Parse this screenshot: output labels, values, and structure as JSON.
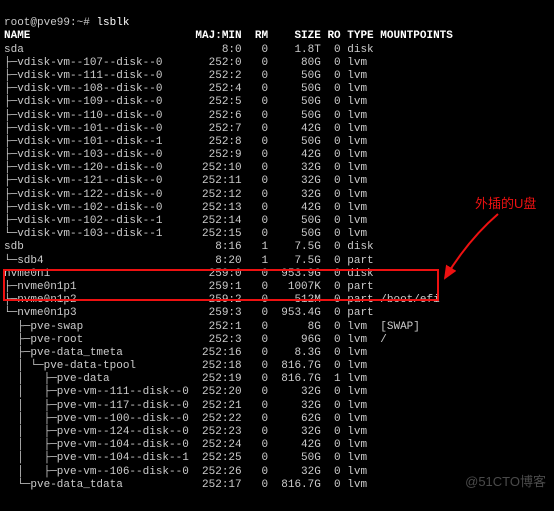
{
  "prompt": {
    "user": "root@pve99",
    "path": "~",
    "cmd": "lsblk"
  },
  "hdr": {
    "name": "NAME",
    "mm": "MAJ:MIN",
    "rm": "RM",
    "size": "SIZE",
    "ro": "RO",
    "type": "TYPE",
    "mp": "MOUNTPOINTS"
  },
  "rows": [
    {
      "n": "sda",
      "mm": "8:0",
      "rm": "0",
      "sz": "1.8T",
      "ro": "0",
      "ty": "disk",
      "mp": ""
    },
    {
      "n": "├─vdisk-vm--107--disk--0",
      "mm": "252:0",
      "rm": "0",
      "sz": "80G",
      "ro": "0",
      "ty": "lvm",
      "mp": ""
    },
    {
      "n": "├─vdisk-vm--111--disk--0",
      "mm": "252:2",
      "rm": "0",
      "sz": "50G",
      "ro": "0",
      "ty": "lvm",
      "mp": ""
    },
    {
      "n": "├─vdisk-vm--108--disk--0",
      "mm": "252:4",
      "rm": "0",
      "sz": "50G",
      "ro": "0",
      "ty": "lvm",
      "mp": ""
    },
    {
      "n": "├─vdisk-vm--109--disk--0",
      "mm": "252:5",
      "rm": "0",
      "sz": "50G",
      "ro": "0",
      "ty": "lvm",
      "mp": ""
    },
    {
      "n": "├─vdisk-vm--110--disk--0",
      "mm": "252:6",
      "rm": "0",
      "sz": "50G",
      "ro": "0",
      "ty": "lvm",
      "mp": ""
    },
    {
      "n": "├─vdisk-vm--101--disk--0",
      "mm": "252:7",
      "rm": "0",
      "sz": "42G",
      "ro": "0",
      "ty": "lvm",
      "mp": ""
    },
    {
      "n": "├─vdisk-vm--101--disk--1",
      "mm": "252:8",
      "rm": "0",
      "sz": "50G",
      "ro": "0",
      "ty": "lvm",
      "mp": ""
    },
    {
      "n": "├─vdisk-vm--103--disk--0",
      "mm": "252:9",
      "rm": "0",
      "sz": "42G",
      "ro": "0",
      "ty": "lvm",
      "mp": ""
    },
    {
      "n": "├─vdisk-vm--120--disk--0",
      "mm": "252:10",
      "rm": "0",
      "sz": "32G",
      "ro": "0",
      "ty": "lvm",
      "mp": ""
    },
    {
      "n": "├─vdisk-vm--121--disk--0",
      "mm": "252:11",
      "rm": "0",
      "sz": "32G",
      "ro": "0",
      "ty": "lvm",
      "mp": ""
    },
    {
      "n": "├─vdisk-vm--122--disk--0",
      "mm": "252:12",
      "rm": "0",
      "sz": "32G",
      "ro": "0",
      "ty": "lvm",
      "mp": ""
    },
    {
      "n": "├─vdisk-vm--102--disk--0",
      "mm": "252:13",
      "rm": "0",
      "sz": "42G",
      "ro": "0",
      "ty": "lvm",
      "mp": ""
    },
    {
      "n": "├─vdisk-vm--102--disk--1",
      "mm": "252:14",
      "rm": "0",
      "sz": "50G",
      "ro": "0",
      "ty": "lvm",
      "mp": ""
    },
    {
      "n": "└─vdisk-vm--103--disk--1",
      "mm": "252:15",
      "rm": "0",
      "sz": "50G",
      "ro": "0",
      "ty": "lvm",
      "mp": ""
    },
    {
      "n": "sdb",
      "mm": "8:16",
      "rm": "1",
      "sz": "7.5G",
      "ro": "0",
      "ty": "disk",
      "mp": ""
    },
    {
      "n": "└─sdb4",
      "mm": "8:20",
      "rm": "1",
      "sz": "7.5G",
      "ro": "0",
      "ty": "part",
      "mp": ""
    },
    {
      "n": "nvme0n1",
      "mm": "259:0",
      "rm": "0",
      "sz": "953.9G",
      "ro": "0",
      "ty": "disk",
      "mp": ""
    },
    {
      "n": "├─nvme0n1p1",
      "mm": "259:1",
      "rm": "0",
      "sz": "1007K",
      "ro": "0",
      "ty": "part",
      "mp": ""
    },
    {
      "n": "├─nvme0n1p2",
      "mm": "259:2",
      "rm": "0",
      "sz": "512M",
      "ro": "0",
      "ty": "part",
      "mp": "/boot/efi"
    },
    {
      "n": "└─nvme0n1p3",
      "mm": "259:3",
      "rm": "0",
      "sz": "953.4G",
      "ro": "0",
      "ty": "part",
      "mp": ""
    },
    {
      "n": "  ├─pve-swap",
      "mm": "252:1",
      "rm": "0",
      "sz": "8G",
      "ro": "0",
      "ty": "lvm",
      "mp": "[SWAP]"
    },
    {
      "n": "  ├─pve-root",
      "mm": "252:3",
      "rm": "0",
      "sz": "96G",
      "ro": "0",
      "ty": "lvm",
      "mp": "/"
    },
    {
      "n": "  ├─pve-data_tmeta",
      "mm": "252:16",
      "rm": "0",
      "sz": "8.3G",
      "ro": "0",
      "ty": "lvm",
      "mp": ""
    },
    {
      "n": "  │ └─pve-data-tpool",
      "mm": "252:18",
      "rm": "0",
      "sz": "816.7G",
      "ro": "0",
      "ty": "lvm",
      "mp": ""
    },
    {
      "n": "  │   ├─pve-data",
      "mm": "252:19",
      "rm": "0",
      "sz": "816.7G",
      "ro": "1",
      "ty": "lvm",
      "mp": ""
    },
    {
      "n": "  │   ├─pve-vm--111--disk--0",
      "mm": "252:20",
      "rm": "0",
      "sz": "32G",
      "ro": "0",
      "ty": "lvm",
      "mp": ""
    },
    {
      "n": "  │   ├─pve-vm--117--disk--0",
      "mm": "252:21",
      "rm": "0",
      "sz": "32G",
      "ro": "0",
      "ty": "lvm",
      "mp": ""
    },
    {
      "n": "  │   ├─pve-vm--100--disk--0",
      "mm": "252:22",
      "rm": "0",
      "sz": "62G",
      "ro": "0",
      "ty": "lvm",
      "mp": ""
    },
    {
      "n": "  │   ├─pve-vm--124--disk--0",
      "mm": "252:23",
      "rm": "0",
      "sz": "32G",
      "ro": "0",
      "ty": "lvm",
      "mp": ""
    },
    {
      "n": "  │   ├─pve-vm--104--disk--0",
      "mm": "252:24",
      "rm": "0",
      "sz": "42G",
      "ro": "0",
      "ty": "lvm",
      "mp": ""
    },
    {
      "n": "  │   ├─pve-vm--104--disk--1",
      "mm": "252:25",
      "rm": "0",
      "sz": "50G",
      "ro": "0",
      "ty": "lvm",
      "mp": ""
    },
    {
      "n": "  │   ├─pve-vm--106--disk--0",
      "mm": "252:26",
      "rm": "0",
      "sz": "32G",
      "ro": "0",
      "ty": "lvm",
      "mp": ""
    },
    {
      "n": "  └─pve-data_tdata",
      "mm": "252:17",
      "rm": "0",
      "sz": "816.7G",
      "ro": "0",
      "ty": "lvm",
      "mp": ""
    }
  ],
  "annotation": "外插的U盘",
  "watermark": "@51CTO博客"
}
